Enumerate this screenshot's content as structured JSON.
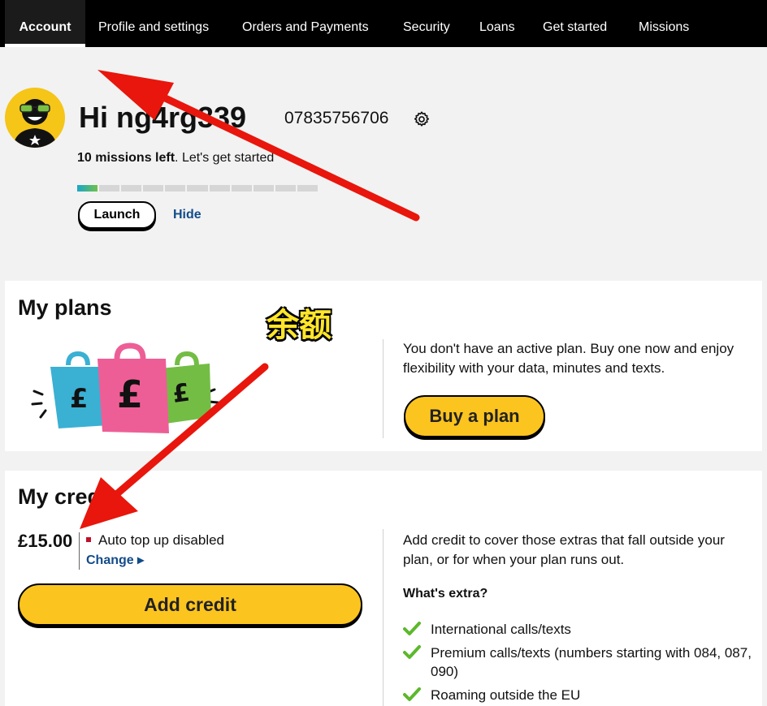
{
  "nav": {
    "tabs": [
      {
        "label": "Account",
        "active": true
      },
      {
        "label": "Profile and settings"
      },
      {
        "label": "Orders and Payments"
      },
      {
        "label": "Security"
      },
      {
        "label": "Loans"
      },
      {
        "label": "Get started"
      },
      {
        "label": "Missions"
      }
    ]
  },
  "profile": {
    "greeting": "Hi ng4rg339",
    "phone": "07835756706",
    "missions_bold": "10 missions left",
    "missions_rest": ". Let's get started",
    "progress": {
      "completed": 1,
      "total": 11
    },
    "launch_label": "Launch",
    "hide_label": "Hide"
  },
  "plans": {
    "title": "My plans",
    "description": "You don't have an active plan. Buy one now and enjoy flexibility with your data, minutes and texts.",
    "buy_label": "Buy a plan"
  },
  "credit": {
    "title": "My credit",
    "amount": "£15.00",
    "auto_top_up": "Auto top up disabled",
    "change_label": "Change ▸",
    "add_label": "Add credit",
    "description": "Add credit to cover those extras that fall outside your plan, or for when your plan runs out.",
    "extras_heading": "What's extra?",
    "extras": [
      "International calls/texts",
      "Premium calls/texts (numbers starting with 084, 087, 090)",
      "Roaming outside the EU"
    ]
  },
  "annotation": {
    "label": "余额",
    "arrow_color": "#e8160c",
    "label_color": "#ffe52b"
  },
  "colors": {
    "nav_bg": "#000000",
    "accent_yellow": "#fcc41f",
    "link_blue": "#134b8a",
    "check_green": "#5cb82c",
    "status_red": "#c0102a"
  }
}
